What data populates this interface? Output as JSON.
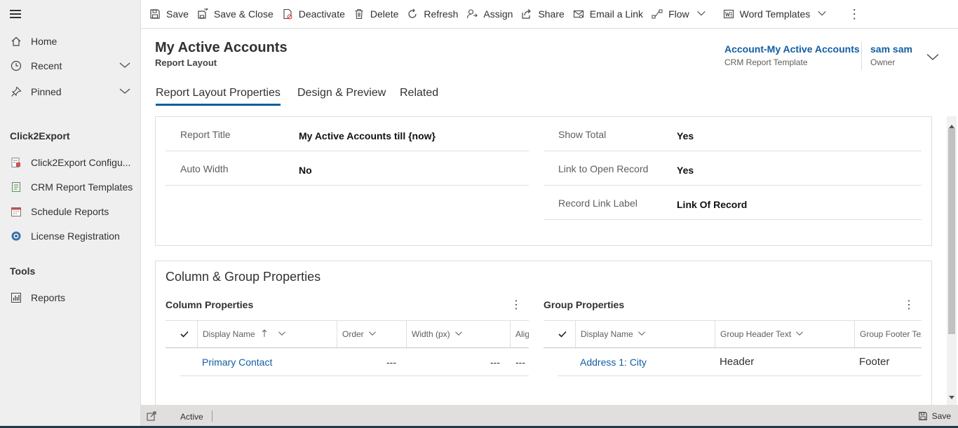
{
  "sidebar": {
    "items": [
      {
        "label": "Home",
        "icon": "home-icon"
      },
      {
        "label": "Recent",
        "icon": "clock-icon"
      },
      {
        "label": "Pinned",
        "icon": "pin-icon"
      }
    ],
    "sections": [
      {
        "title": "Click2Export",
        "items": [
          {
            "label": "Click2Export Configu...",
            "icon": "config-icon"
          },
          {
            "label": "CRM Report Templates",
            "icon": "template-icon"
          },
          {
            "label": "Schedule Reports",
            "icon": "calendar-icon"
          },
          {
            "label": "License Registration",
            "icon": "license-icon"
          }
        ]
      },
      {
        "title": "Tools",
        "items": [
          {
            "label": "Reports",
            "icon": "reports-icon"
          }
        ]
      }
    ]
  },
  "commandbar": {
    "save": "Save",
    "save_close": "Save & Close",
    "deactivate": "Deactivate",
    "delete": "Delete",
    "refresh": "Refresh",
    "assign": "Assign",
    "share": "Share",
    "email_link": "Email a Link",
    "flow": "Flow",
    "word_templates": "Word Templates"
  },
  "header": {
    "title": "My Active Accounts",
    "subtitle": "Report Layout",
    "field1_value": "Account-My Active Accounts",
    "field1_label": "CRM Report Template",
    "owner_value": "sam sam",
    "owner_label": "Owner"
  },
  "tabs": [
    {
      "label": "Report Layout Properties",
      "active": true
    },
    {
      "label": "Design & Preview",
      "active": false
    },
    {
      "label": "Related",
      "active": false
    }
  ],
  "properties": {
    "report_title_label": "Report Title",
    "report_title_value": "My Active Accounts till {now}",
    "auto_width_label": "Auto Width",
    "auto_width_value": "No",
    "show_total_label": "Show Total",
    "show_total_value": "Yes",
    "link_open_label": "Link to Open Record",
    "link_open_value": "Yes",
    "record_link_label_label": "Record Link Label",
    "record_link_label_value": "Link Of Record"
  },
  "column_group": {
    "title": "Column & Group Properties",
    "column_grid": {
      "title": "Column Properties",
      "headers": [
        "Display Name",
        "Order",
        "Width (px)",
        "Alig"
      ],
      "rows": [
        {
          "display_name": "Primary Contact",
          "order": "---",
          "width": "---",
          "align": "---"
        }
      ]
    },
    "group_grid": {
      "title": "Group Properties",
      "headers": [
        "Display Name",
        "Group Header Text",
        "Group Footer Tex"
      ],
      "rows": [
        {
          "display_name": "Address 1: City",
          "header_text": "Header",
          "footer_text": "Footer"
        }
      ]
    }
  },
  "statusbar": {
    "status": "Active",
    "save": "Save"
  },
  "colors": {
    "accent": "#115ea3",
    "sidebar_bg": "#efefef",
    "statusbar_bg": "#e1dfdd"
  }
}
